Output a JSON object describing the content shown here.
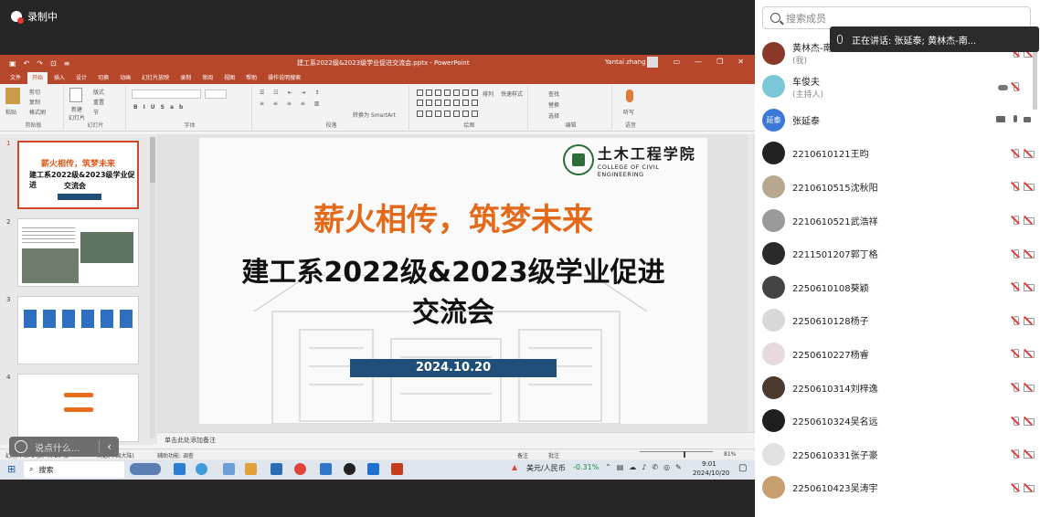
{
  "recording": {
    "label": "录制中"
  },
  "ppt": {
    "window_title": "建工系2022级&2023级学业促进交流会.pptx - PowerPoint",
    "user": "Yantai zhang",
    "tabs": [
      "文件",
      "开始",
      "插入",
      "设计",
      "切换",
      "动画",
      "幻灯片放映",
      "录制",
      "审阅",
      "视图",
      "帮助",
      "操作说明搜索"
    ],
    "active_tab": "开始",
    "ribbon": {
      "clipboard": {
        "label": "剪贴板",
        "paste": "粘贴",
        "cut": "剪切",
        "copy": "复制",
        "format_painter": "格式刷"
      },
      "slides": {
        "label": "幻灯片",
        "new_slide": "新建\n幻灯片",
        "layout": "版式",
        "reset": "重置",
        "section": "节"
      },
      "font": {
        "label": "字体"
      },
      "paragraph": {
        "label": "段落",
        "smartart": "转换为 SmartArt"
      },
      "drawing": {
        "label": "绘图",
        "arrange": "排列",
        "quick_styles": "快速样式"
      },
      "editing": {
        "label": "编辑",
        "find": "查找",
        "replace": "替换",
        "select": "选择"
      },
      "voice": {
        "label": "语音",
        "dictate": "听写"
      }
    },
    "slide_numbers": [
      "1",
      "2",
      "3",
      "4"
    ],
    "thumb1": {
      "line1": "薪火相传，筑梦未来",
      "line2": "建工系2022级&2023级学业促进",
      "line3": "交流会"
    },
    "slide": {
      "logo_name": "土木工程学院",
      "logo_sub": "COLLEGE OF CIVIL ENGINEERING",
      "title1": "薪火相传，筑梦未来",
      "title2": "建工系2022级&2023级学业促进",
      "title3": "交流会",
      "date": "2024.10.20"
    },
    "notes_placeholder": "单击此处添加备注",
    "status": {
      "slide_pos": "幻灯片 第 1 张，共 20 张",
      "language": "英语(中国大陆)",
      "accessibility": "辅助功能: 调查",
      "notes": "备注",
      "comments": "批注",
      "zoom": "81%"
    }
  },
  "taskbar": {
    "search": "搜索",
    "currency": "美元/人民币",
    "change": "-0.31%",
    "time": "9:01",
    "date": "2024/10/20"
  },
  "chat": {
    "placeholder": "说点什么..."
  },
  "panel": {
    "search_placeholder": "搜索成员",
    "speaking": "正在讲话:  张延泰; 黄林杰-南...",
    "members": [
      {
        "name": "黄林杰-南京林业大学",
        "role": "(我)",
        "color": "#8b3a2a",
        "mic": "off",
        "cam": "off"
      },
      {
        "name": "车俊夫",
        "role": "(主持人)",
        "color": "#7ac7d8",
        "mic": "off",
        "cam": "none",
        "cloud": true
      },
      {
        "name": "张延泰",
        "role": "",
        "color": "#3b78d8",
        "mic": "on",
        "cam": "on",
        "share": true,
        "avatar_text": "延泰"
      },
      {
        "name": "2210610121王昀",
        "role": "",
        "color": "#222222",
        "mic": "off",
        "cam": "off"
      },
      {
        "name": "2210610515沈秋阳",
        "role": "",
        "color": "#b8a890",
        "mic": "off",
        "cam": "off"
      },
      {
        "name": "2210610521武浩祥",
        "role": "",
        "color": "#9a9a9a",
        "mic": "off",
        "cam": "off"
      },
      {
        "name": "2211501207郭丁格",
        "role": "",
        "color": "#2a2a2a",
        "mic": "off",
        "cam": "off"
      },
      {
        "name": "2250610108葵颖",
        "role": "",
        "color": "#444444",
        "mic": "off",
        "cam": "off"
      },
      {
        "name": "2250610128杨子",
        "role": "",
        "color": "#d8d8d8",
        "mic": "off",
        "cam": "off"
      },
      {
        "name": "2250610227杨睿",
        "role": "",
        "color": "#e8d8e0",
        "mic": "off",
        "cam": "off"
      },
      {
        "name": "2250610314刘梓逸",
        "role": "",
        "color": "#4a3a30",
        "mic": "off",
        "cam": "off"
      },
      {
        "name": "2250610324吴名远",
        "role": "",
        "color": "#1e1e1e",
        "mic": "off",
        "cam": "off"
      },
      {
        "name": "2250610331张子豪",
        "role": "",
        "color": "#e2e2e2",
        "mic": "off",
        "cam": "off"
      },
      {
        "name": "2250610423吴涛宇",
        "role": "",
        "color": "#c8a070",
        "mic": "off",
        "cam": "off"
      }
    ]
  }
}
